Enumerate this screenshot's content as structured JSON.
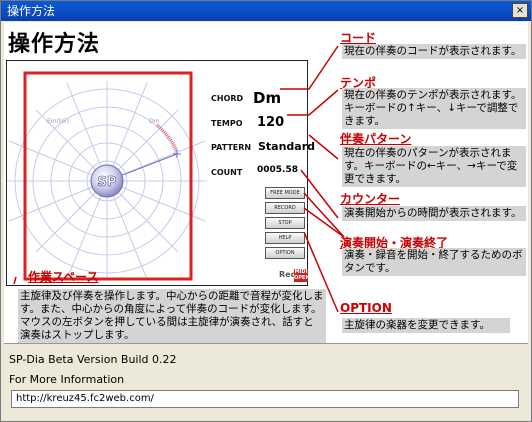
{
  "window": {
    "title": "操作方法",
    "close_label": "×"
  },
  "page": {
    "heading": "操作方法"
  },
  "panel": {
    "chord_label": "CHORD",
    "chord_value": "Dm",
    "tempo_label": "TEMPO",
    "tempo_value": "120",
    "pattern_label": "PATTERN",
    "pattern_value": "Standard",
    "count_label": "COUNT",
    "count_value": "0005.58",
    "sp_label": "SP",
    "circle_labels": [
      "Em(b5)",
      "Dm"
    ],
    "buttons": [
      "FREE MODE",
      "RECORD",
      "STOP",
      "HELP",
      "OPTION"
    ],
    "rec_logo": "Rec",
    "midi_logo_top": "MIDI",
    "midi_logo_bottom": "OPEN"
  },
  "annotations": {
    "chord": {
      "title": "コード",
      "desc": "現在の伴奏のコードが表示されます。"
    },
    "tempo": {
      "title": "テンポ",
      "desc": "現在の伴奏のテンポが表示されます。キーボードの↑キー、↓キーで調整できます。"
    },
    "pattern": {
      "title": "伴奏パターン",
      "desc": "現在の伴奏のパターンが表示されます。キーボードの←キー、→キーで変更できます。"
    },
    "counter": {
      "title": "カウンター",
      "desc": "演奏開始からの時間が表示されます。"
    },
    "startstop": {
      "title": "演奏開始・演奏終了",
      "desc": "演奏・録音を開始・終了するためのボタンです。"
    },
    "workspace": {
      "title": "作業スペース",
      "desc": "主旋律及び伴奏を操作します。中心からの距離で音程が変化します。また、中心からの角度によって伴奏のコードが変化します。マウスの左ボタンを押している間は主旋律が演奏され、話すと演奏はストップします。"
    },
    "option": {
      "title": "OPTION",
      "desc": "主旋律の楽器を変更できます。"
    }
  },
  "footer": {
    "version": "SP-Dia Beta Version Build 0.22",
    "more_info": "For More Information",
    "url": "http://kreuz45.fc2web.com/"
  },
  "colors": {
    "annotation_red": "#cc0000",
    "highlight_red": "#e02020",
    "titlebar_blue": "#0a4fc8",
    "desc_gray": "#d4d4d4"
  }
}
